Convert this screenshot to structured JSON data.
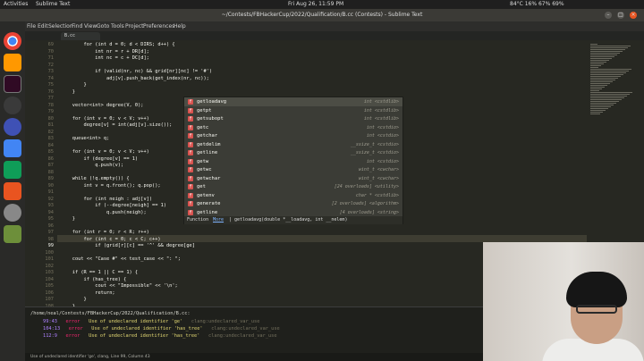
{
  "system_bar": {
    "activities": "Activities",
    "app": "Sublime Text",
    "clock": "Fri Aug 26, 11:59 PM",
    "status": "84°C  16% 67%  69%"
  },
  "window": {
    "title": "~/Contests/FBHackerCup/2022/Qualification/B.cc (Contests) - Sublime Text"
  },
  "menu": [
    "File",
    "Edit",
    "Selection",
    "Find",
    "View",
    "Goto",
    "Tools",
    "Project",
    "Preferences",
    "Help"
  ],
  "tab": {
    "label": "B.cc"
  },
  "editor": {
    "current_line": "99",
    "lines": [
      {
        "n": "69",
        "code": "        for (int d = 0; d < DIRS; d++) {"
      },
      {
        "n": "70",
        "code": "            int nr = r + DR[d];"
      },
      {
        "n": "71",
        "code": "            int nc = c + DC[d];"
      },
      {
        "n": "72",
        "code": ""
      },
      {
        "n": "73",
        "code": "            if (valid(nr, nc) && grid[nr][nc] != '#')"
      },
      {
        "n": "74",
        "code": "                adj[v].push_back(get_index(nr, nc));"
      },
      {
        "n": "75",
        "code": "        }"
      },
      {
        "n": "76",
        "code": "    }"
      },
      {
        "n": "77",
        "code": ""
      },
      {
        "n": "78",
        "code": "    vector<int> degree(V, 0);"
      },
      {
        "n": "79",
        "code": ""
      },
      {
        "n": "80",
        "code": "    for (int v = 0; v < V; v++)"
      },
      {
        "n": "81",
        "code": "        degree[v] = int(adj[v].size());"
      },
      {
        "n": "82",
        "code": ""
      },
      {
        "n": "83",
        "code": "    queue<int> q;"
      },
      {
        "n": "84",
        "code": ""
      },
      {
        "n": "85",
        "code": "    for (int v = 0; v < V; v++)"
      },
      {
        "n": "86",
        "code": "        if (degree[v] == 1)"
      },
      {
        "n": "87",
        "code": "            q.push(v);"
      },
      {
        "n": "88",
        "code": ""
      },
      {
        "n": "89",
        "code": "    while (!q.empty()) {"
      },
      {
        "n": "90",
        "code": "        int v = q.front(); q.pop();"
      },
      {
        "n": "91",
        "code": ""
      },
      {
        "n": "92",
        "code": "        for (int neigh : adj[v])"
      },
      {
        "n": "93",
        "code": "            if (--degree[neigh] == 1)"
      },
      {
        "n": "94",
        "code": "                q.push(neigh);"
      },
      {
        "n": "95",
        "code": "    }"
      },
      {
        "n": "96",
        "code": ""
      },
      {
        "n": "97",
        "code": "    for (int r = 0; r < R; r++)"
      },
      {
        "n": "98",
        "code": "        for (int c = 0; c < C; c++)"
      },
      {
        "n": "99",
        "code": "            if (grid[r][c] == '^' && degree[ge]"
      },
      {
        "n": "100",
        "code": ""
      },
      {
        "n": "101",
        "code": "    cout << \"Case #\" << test_case << \": \";"
      },
      {
        "n": "102",
        "code": ""
      },
      {
        "n": "103",
        "code": "    if (R == 1 || C == 1) {"
      },
      {
        "n": "104",
        "code": "        if (has_tree) {"
      },
      {
        "n": "105",
        "code": "            cout << \"Impossible\" << '\\n';"
      },
      {
        "n": "106",
        "code": "            return;"
      },
      {
        "n": "107",
        "code": "        }"
      },
      {
        "n": "108",
        "code": "    }"
      }
    ]
  },
  "autocomplete": {
    "items": [
      {
        "name": "getloadavg",
        "type": "int <cstdlib>"
      },
      {
        "name": "getpt",
        "type": "int <cstdlib>"
      },
      {
        "name": "getsubopt",
        "type": "int <cstdlib>"
      },
      {
        "name": "getc",
        "type": "int <cstdio>"
      },
      {
        "name": "getchar",
        "type": "int <cstdio>"
      },
      {
        "name": "getdelim",
        "type": "__ssize_t <cstdio>"
      },
      {
        "name": "getline",
        "type": "__ssize_t <cstdio>"
      },
      {
        "name": "getw",
        "type": "int <cstdio>"
      },
      {
        "name": "getwc",
        "type": "wint_t <cwchar>"
      },
      {
        "name": "getwchar",
        "type": "wint_t <cwchar>"
      },
      {
        "name": "get",
        "type": "[24 overloads] <utility>"
      },
      {
        "name": "getenv",
        "type": "char * <cstdlib>"
      },
      {
        "name": "generate",
        "type": "[2 overloads] <algorithm>"
      },
      {
        "name": "getline",
        "type": "[4 overloads] <string>"
      }
    ],
    "footer_label": "Function",
    "footer_more": "More",
    "footer_signature": "| getloadavg(double *__loadavg, int __nelem)"
  },
  "build_panel": {
    "path": "/home/neal/Contests/FBHackerCup/2022/Qualification/B.cc:",
    "errors": [
      {
        "loc": "99:43",
        "level": "error",
        "msg": "Use of undeclared identifier 'ge'",
        "tag": "clang:undeclared_var_use"
      },
      {
        "loc": "104:13",
        "level": "error",
        "msg": "Use of undeclared identifier 'has_tree'",
        "tag": "clang:undeclared_var_use"
      },
      {
        "loc": "112:9",
        "level": "error",
        "msg": "Use of undeclared identifier 'has_tree'",
        "tag": "clang:undeclared_var_use"
      }
    ]
  },
  "status_bar": {
    "text": "Use of undeclared identifier 'ge', clang, Line 99, Column 43"
  },
  "dock_icons": [
    "chrome-icon",
    "sublime-text-icon",
    "terminal-icon",
    "obs-icon",
    "eclipse-icon",
    "docs-icon",
    "sheets-icon",
    "store-icon",
    "settings-icon",
    "trash-icon"
  ],
  "colors": {
    "editor_bg": "#272822",
    "keyword": "#f92672",
    "type": "#66d9ef",
    "error_dot": "#d9534f"
  }
}
